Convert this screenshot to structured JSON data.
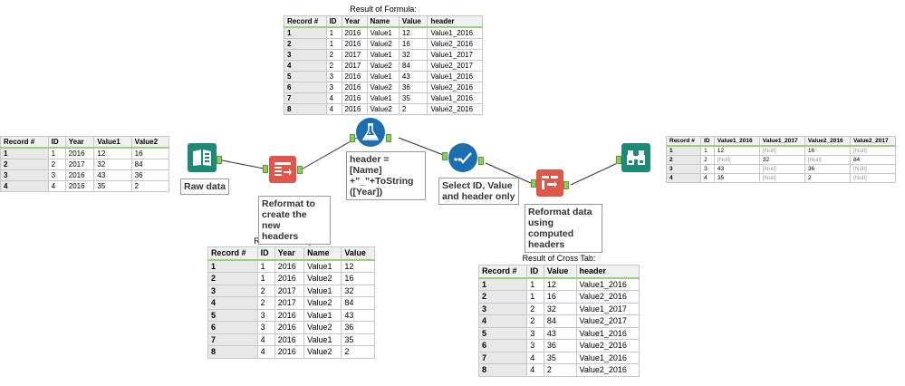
{
  "captions": {
    "formula": "Result of Formula:",
    "transpose": "Result of Transpose:",
    "crosstab": "Result of Cross Tab:"
  },
  "tools": {
    "input": {
      "icon": "book-icon",
      "label": "Raw data",
      "color": "#1b8a76"
    },
    "transpose": {
      "icon": "transpose-icon",
      "label": "Reformat to\ncreate the new\nheaders",
      "color": "#e0574a"
    },
    "formula": {
      "icon": "flask-icon",
      "label": "header = [Name]\n+\"_\"+ToString\n([Year])",
      "color": "#1b6fb0"
    },
    "select": {
      "icon": "checkmark-icon",
      "label": "Select ID, Value\nand header only",
      "color": "#1b6fb0"
    },
    "crosstab": {
      "icon": "crosstab-icon",
      "label": "Reformat data\nusing computed\nheaders",
      "color": "#e0574a"
    },
    "browse": {
      "icon": "binoculars-icon",
      "label": "",
      "color": "#1b8a76"
    }
  },
  "raw_table": {
    "headers": [
      "Record #",
      "ID",
      "Year",
      "Value1",
      "Value2"
    ],
    "rows": [
      [
        "1",
        "1",
        "2016",
        "12",
        "16"
      ],
      [
        "2",
        "2",
        "2017",
        "32",
        "84"
      ],
      [
        "3",
        "3",
        "2016",
        "43",
        "36"
      ],
      [
        "4",
        "4",
        "2016",
        "35",
        "2"
      ]
    ]
  },
  "formula_table": {
    "headers": [
      "Record #",
      "ID",
      "Year",
      "Name",
      "Value",
      "header"
    ],
    "rows": [
      [
        "1",
        "1",
        "2016",
        "Value1",
        "12",
        "Value1_2016"
      ],
      [
        "2",
        "1",
        "2016",
        "Value2",
        "16",
        "Value2_2016"
      ],
      [
        "3",
        "2",
        "2017",
        "Value1",
        "32",
        "Value1_2017"
      ],
      [
        "4",
        "2",
        "2017",
        "Value2",
        "84",
        "Value2_2017"
      ],
      [
        "5",
        "3",
        "2016",
        "Value1",
        "43",
        "Value1_2016"
      ],
      [
        "6",
        "3",
        "2016",
        "Value2",
        "36",
        "Value2_2016"
      ],
      [
        "7",
        "4",
        "2016",
        "Value1",
        "35",
        "Value1_2016"
      ],
      [
        "8",
        "4",
        "2016",
        "Value2",
        "2",
        "Value2_2016"
      ]
    ]
  },
  "transpose_table": {
    "headers": [
      "Record #",
      "ID",
      "Year",
      "Name",
      "Value"
    ],
    "rows": [
      [
        "1",
        "1",
        "2016",
        "Value1",
        "12"
      ],
      [
        "2",
        "1",
        "2016",
        "Value2",
        "16"
      ],
      [
        "3",
        "2",
        "2017",
        "Value1",
        "32"
      ],
      [
        "4",
        "2",
        "2017",
        "Value2",
        "84"
      ],
      [
        "5",
        "3",
        "2016",
        "Value1",
        "43"
      ],
      [
        "6",
        "3",
        "2016",
        "Value2",
        "36"
      ],
      [
        "7",
        "4",
        "2016",
        "Value1",
        "35"
      ],
      [
        "8",
        "4",
        "2016",
        "Value2",
        "2"
      ]
    ]
  },
  "crosstab_table": {
    "headers": [
      "Record #",
      "ID",
      "Value",
      "header"
    ],
    "rows": [
      [
        "1",
        "1",
        "12",
        "Value1_2016"
      ],
      [
        "2",
        "1",
        "16",
        "Value2_2016"
      ],
      [
        "3",
        "2",
        "32",
        "Value1_2017"
      ],
      [
        "4",
        "2",
        "84",
        "Value2_2017"
      ],
      [
        "5",
        "3",
        "43",
        "Value1_2016"
      ],
      [
        "6",
        "3",
        "36",
        "Value2_2016"
      ],
      [
        "7",
        "4",
        "35",
        "Value1_2016"
      ],
      [
        "8",
        "4",
        "2",
        "Value2_2016"
      ]
    ]
  },
  "output_table": {
    "headers": [
      "Record #",
      "ID",
      "Value1_2016",
      "Value1_2017",
      "Value2_2016",
      "Value2_2017"
    ],
    "rows": [
      [
        "1",
        "1",
        "12",
        "[Null]",
        "16",
        "[Null]"
      ],
      [
        "2",
        "2",
        "[Null]",
        "32",
        "[Null]",
        "84"
      ],
      [
        "3",
        "3",
        "43",
        "[Null]",
        "36",
        "[Null]"
      ],
      [
        "4",
        "4",
        "35",
        "[Null]",
        "2",
        "[Null]"
      ]
    ]
  }
}
